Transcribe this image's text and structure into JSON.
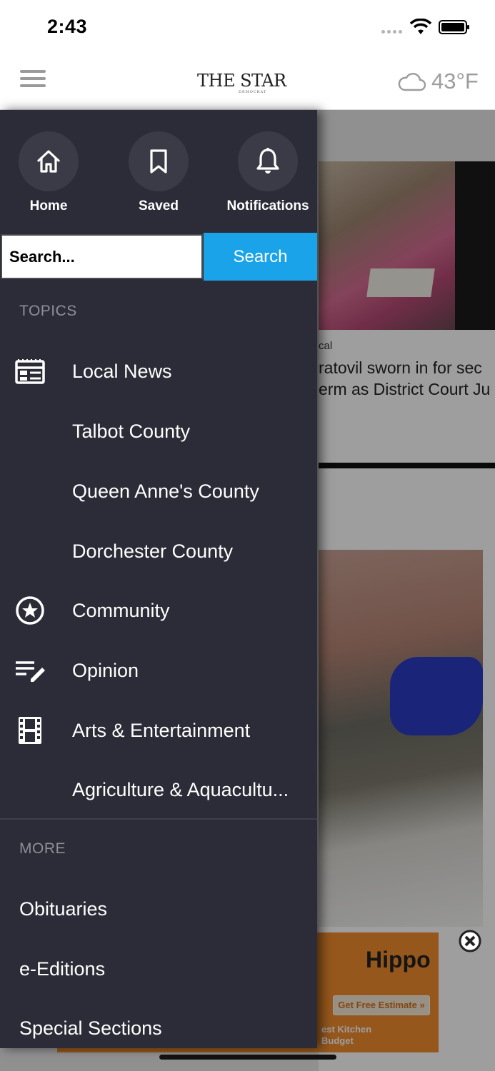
{
  "status_bar": {
    "time": "2:43"
  },
  "header": {
    "logo_text": "THE STAR",
    "logo_sub": "DEMOCRAT",
    "weather_temp": "43°F",
    "weather_icon": "cloud-icon"
  },
  "drawer": {
    "quick_links": [
      {
        "label": "Home",
        "icon": "home-icon"
      },
      {
        "label": "Saved",
        "icon": "bookmark-icon"
      },
      {
        "label": "Notifications",
        "icon": "bell-icon"
      }
    ],
    "search": {
      "placeholder": "Search...",
      "button_label": "Search"
    },
    "topics_label": "TOPICS",
    "topics": [
      {
        "label": "Local News",
        "icon": "newspaper-icon"
      },
      {
        "label": "Talbot County",
        "icon": ""
      },
      {
        "label": "Queen Anne's County",
        "icon": ""
      },
      {
        "label": "Dorchester County",
        "icon": ""
      },
      {
        "label": "Community",
        "icon": "star-circle-icon"
      },
      {
        "label": "Opinion",
        "icon": "edit-note-icon"
      },
      {
        "label": "Arts & Entertainment",
        "icon": "film-icon"
      },
      {
        "label": "Agriculture & Aquacultu..."
      }
    ],
    "more_label": "MORE",
    "more": [
      {
        "label": "Obituaries"
      },
      {
        "label": "e-Editions"
      },
      {
        "label": "Special Sections"
      }
    ]
  },
  "background": {
    "story_category": "cal",
    "story_title_line1": "ratovil sworn in for sec",
    "story_title_line2": "erm as District Court Ju",
    "ad": {
      "brand": "Hippo",
      "cta": "Get Free Estimate »",
      "tagline_line1": "est Kitchen",
      "tagline_line2": "Budget"
    }
  },
  "colors": {
    "drawer_bg": "#2b2c37",
    "search_button": "#1aa3e8",
    "section_label": "#8d8e96"
  }
}
